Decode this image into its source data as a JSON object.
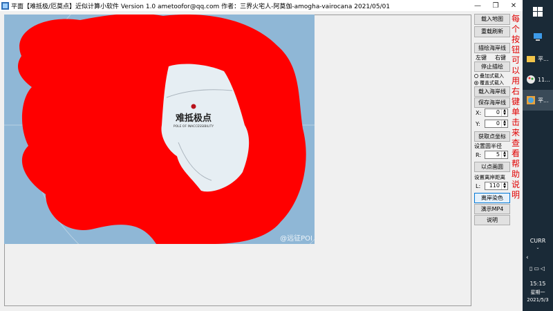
{
  "window": {
    "title": "平面【难抵极/厄莫点】近似计算小软件 Version 1.0  ametoofor@qq.com  作者：三界火宅人-阿莫伽-amogha-vairocana  2021/05/01",
    "controls": [
      "minimize",
      "restore",
      "close"
    ]
  },
  "map": {
    "label_cn": "难抵极点",
    "label_en": "POLE OF INACCESSIBILITY",
    "watermark": "@远征POI",
    "highlight_color": "#ff0000",
    "sea_color": "#8fb7d6",
    "ice_color": "#e6eef3"
  },
  "panel": {
    "load_map": "载入地图",
    "reload": "重载刷新",
    "draw_coast": "描绘海岸线",
    "left_key": "左键",
    "right_key": "右键",
    "stop_draw": "停止描绘",
    "overlay_load": "叠加式载入",
    "overwrite_load": "覆盖式载入",
    "load_coast": "载入海岸线",
    "save_coast": "保存海岸线",
    "x_label": "X:",
    "x_value": "0",
    "y_label": "Y:",
    "y_value": "0",
    "get_coord": "获取点坐标",
    "set_radius": "设置圆半径",
    "r_label": "R:",
    "r_value": "5",
    "draw_circle": "以点画圆",
    "set_distance": "设置离岸距离",
    "l_label": "L:",
    "l_value": "110",
    "color_offshore": "离岸染色",
    "demo_mp4": "演示MP4",
    "explain": "说明"
  },
  "help_text": "每个按钮可以用右键单击来查看帮助说明",
  "taskbar": {
    "app1": "平...",
    "app2": "11...",
    "app3": "平...",
    "ime": "CURR",
    "time": "15:15",
    "weekday": "星期一",
    "date": "2021/5/3"
  }
}
